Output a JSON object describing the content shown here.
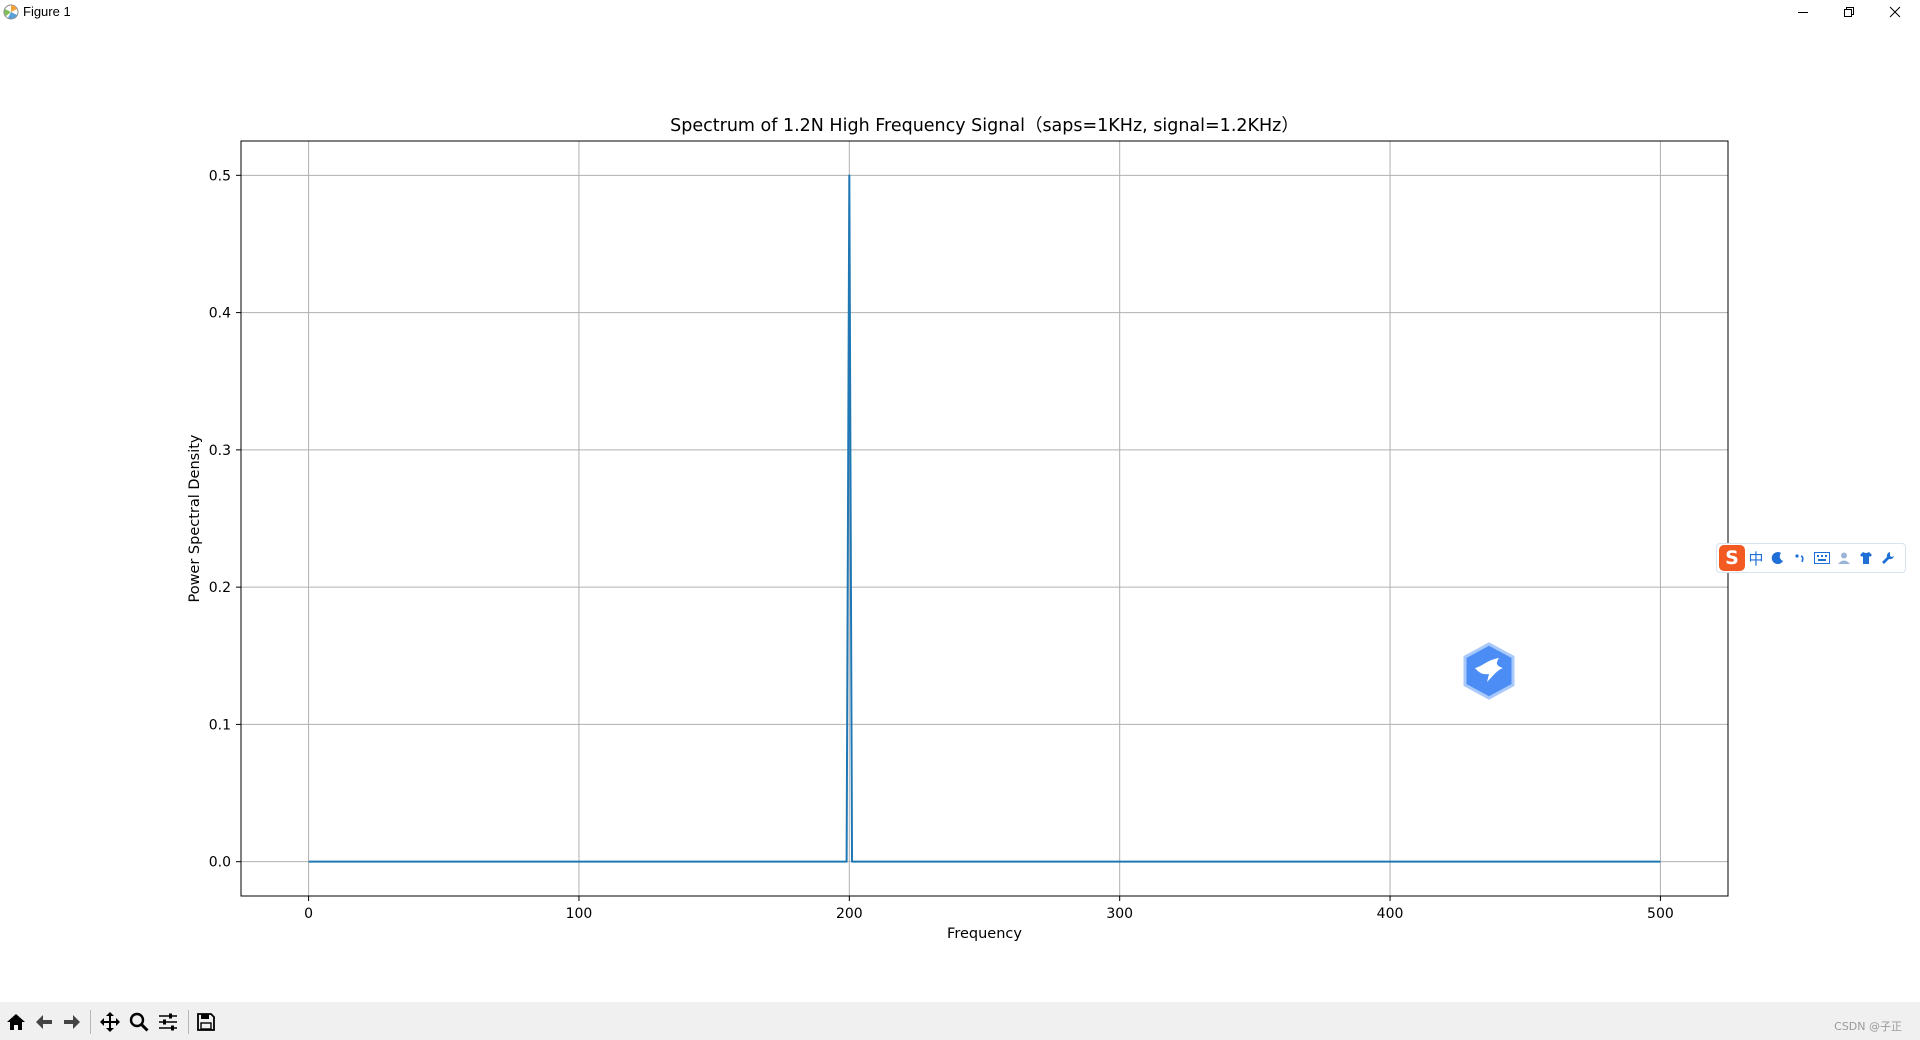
{
  "window": {
    "title": "Figure 1"
  },
  "chart_data": {
    "type": "line",
    "title": "Spectrum of 1.2N High Frequency Signal（saps=1KHz, signal=1.2KHz）",
    "xlabel": "Frequency",
    "ylabel": "Power Spectral Density",
    "xlim": [
      -25,
      525
    ],
    "ylim": [
      -0.025,
      0.525
    ],
    "xticks": [
      0,
      100,
      200,
      300,
      400,
      500
    ],
    "yticks": [
      0.0,
      0.1,
      0.2,
      0.3,
      0.4,
      0.5
    ],
    "ytick_labels": [
      "0.0",
      "0.1",
      "0.2",
      "0.3",
      "0.4",
      "0.5"
    ],
    "grid": true,
    "series": [
      {
        "color": "#1f77b4",
        "x": [
          0,
          199,
          200,
          201,
          500
        ],
        "y": [
          0.0,
          0.0,
          0.5,
          0.0,
          0.0
        ]
      }
    ]
  },
  "toolbar": {
    "buttons": [
      {
        "name": "home-button",
        "icon": "home-icon"
      },
      {
        "name": "back-button",
        "icon": "arrow-left-icon"
      },
      {
        "name": "forward-button",
        "icon": "arrow-right-icon"
      },
      {
        "name": "pan-button",
        "icon": "move-icon"
      },
      {
        "name": "zoom-button",
        "icon": "magnifier-icon"
      },
      {
        "name": "configure-subplots-button",
        "icon": "sliders-icon"
      },
      {
        "name": "save-button",
        "icon": "floppy-disk-icon"
      }
    ],
    "watermark": "CSDN @子正"
  },
  "ime": {
    "logo": "S",
    "mode": "中",
    "icons": [
      "moon-icon",
      "punctuation-icon",
      "keyboard-icon",
      "user-icon",
      "shirt-icon",
      "wrench-icon"
    ]
  },
  "colors": {
    "line": "#1f77b4",
    "grid": "#b0b0b0",
    "toolbar_bg": "#f0f0f0",
    "ime_accent": "#f25a22",
    "badge": "#3b82f6"
  }
}
